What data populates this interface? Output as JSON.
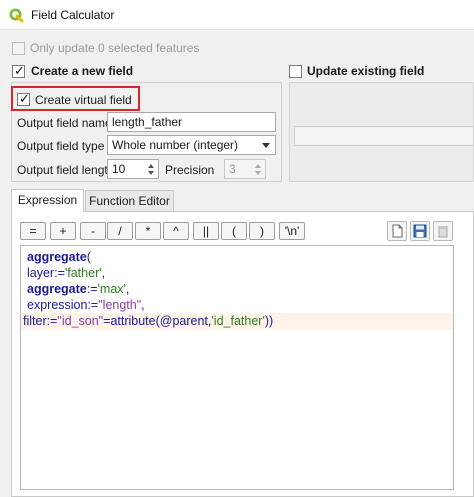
{
  "window": {
    "title": "Field Calculator"
  },
  "options": {
    "only_update_selected_label": "Only update 0 selected features"
  },
  "create_new": {
    "label": "Create a new field",
    "virtual_label": "Create virtual field",
    "output_name_label": "Output field name",
    "output_name_value": "length_father",
    "output_type_label": "Output field type",
    "output_type_value": "Whole number (integer)",
    "output_length_label": "Output field length",
    "output_length_value": "10",
    "precision_label": "Precision",
    "precision_value": "3"
  },
  "update_existing": {
    "label": "Update existing field"
  },
  "tabs": [
    {
      "label": "Expression",
      "active": true
    },
    {
      "label": "Function Editor",
      "active": false
    }
  ],
  "operators": [
    "=",
    "+",
    "-",
    "/",
    "*",
    "^",
    "||",
    "(",
    ")",
    "'\\n'"
  ],
  "expression": {
    "line1": {
      "fn": "aggregate",
      "paren": "("
    },
    "line2": {
      "param": "layer",
      "op": ":=",
      "value": "'father'",
      "sep": ","
    },
    "line3": {
      "param": "aggregate",
      "op": ":=",
      "value": "'max'",
      "sep": ","
    },
    "line4": {
      "param": "expression",
      "op": ":=",
      "value": "\"length\"",
      "sep": ","
    },
    "line5": {
      "param": "filter",
      "op": ":=",
      "value": "\"id_son\"",
      "eq": "=",
      "fn": "attribute",
      "paren_open": "(",
      "var": "@parent",
      "comma": ",",
      "arg": "'id_father'",
      "paren_close": "))"
    }
  },
  "colors": {
    "highlight_border": "#d8262c",
    "keyword": "#1a1a9a",
    "string": "#2d7d1a",
    "variable": "#8a3aa0"
  }
}
